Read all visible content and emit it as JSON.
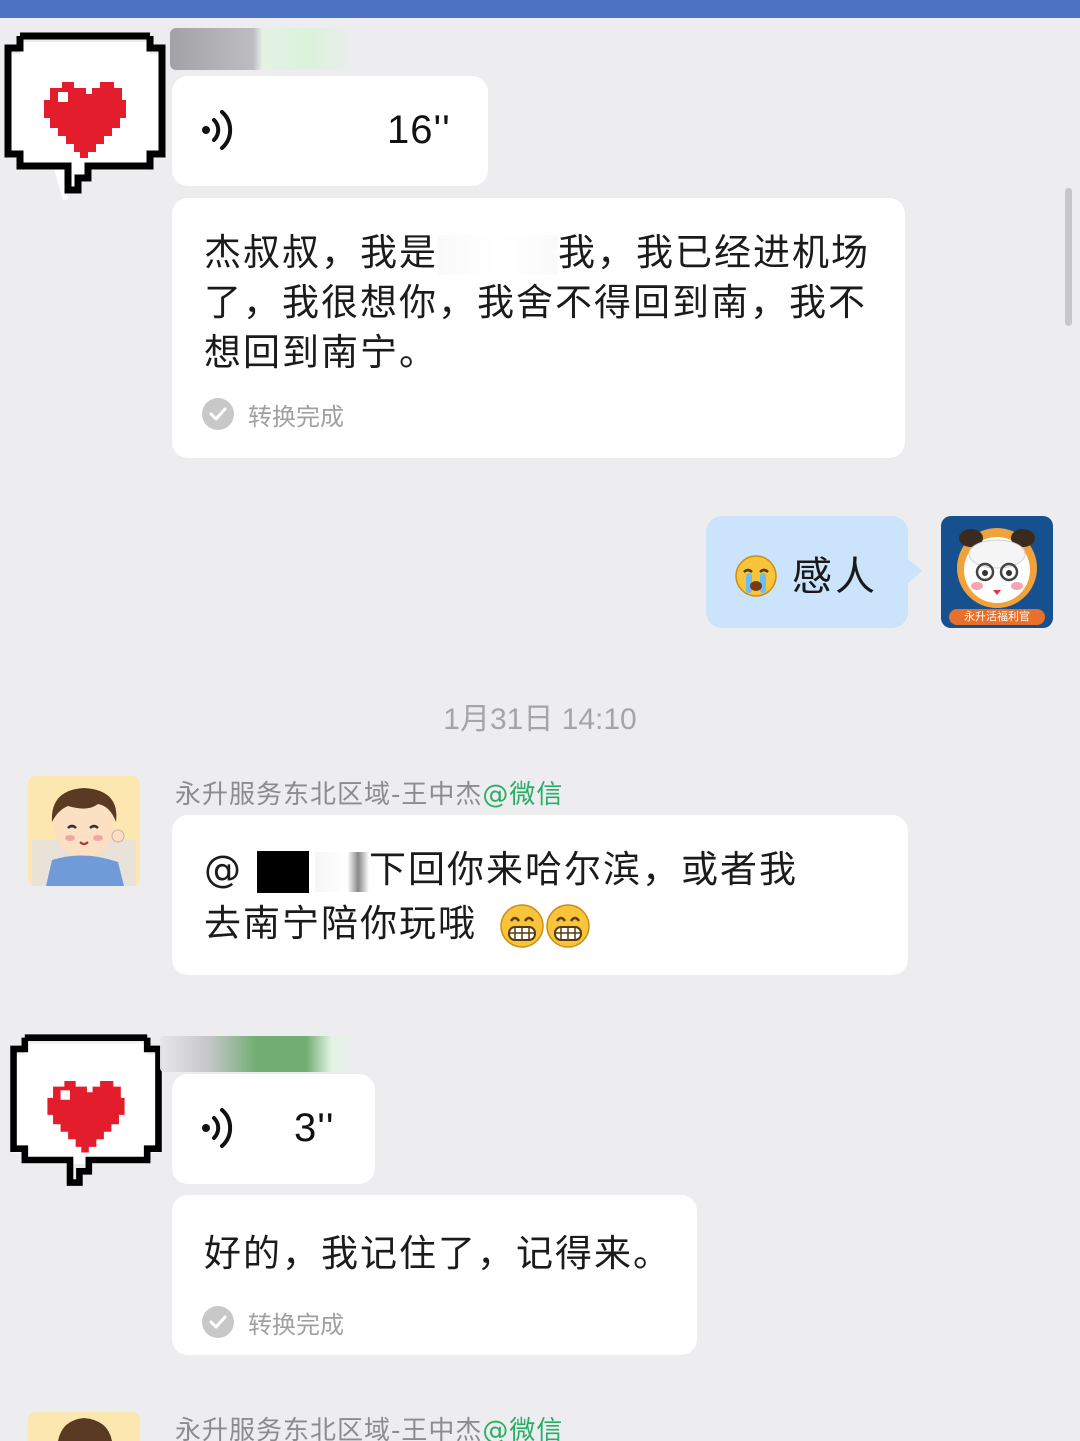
{
  "chat": {
    "voice_msg_1": {
      "duration": "16''"
    },
    "transcript_1": {
      "line1_a": "杰叔叔，我是",
      "line1_b": "我，我已经进机场",
      "line2": "了，我很想你，我舍不得回到南，我不",
      "line3": "想回到南宁。",
      "status": "转换完成"
    },
    "my_reply": {
      "emoji": "crying-face",
      "text": "感人"
    },
    "my_avatar": {
      "badge": "永升活福利官"
    },
    "timestamp": "1月31日 14:10",
    "sender_2": {
      "name": "永升服务东北区域-王中杰",
      "tag": "@微信"
    },
    "msg_2": {
      "prefix": "@",
      "line1": "下回你来哈尔滨，或者我",
      "line2": "去南宁陪你玩哦",
      "emoji": "grinning-face"
    },
    "voice_msg_2": {
      "duration": "3''"
    },
    "transcript_2": {
      "text": "好的，我记住了，记得来。",
      "status": "转换完成"
    },
    "sender_3": {
      "name": "永升服务东北区域-王中杰",
      "tag": "@微信"
    }
  },
  "colors": {
    "background": "#ededf0",
    "bubble": "#ffffff",
    "my_bubble": "#cce4fb",
    "sender_tag": "#2aae67",
    "topbar": "#4a72c0"
  }
}
